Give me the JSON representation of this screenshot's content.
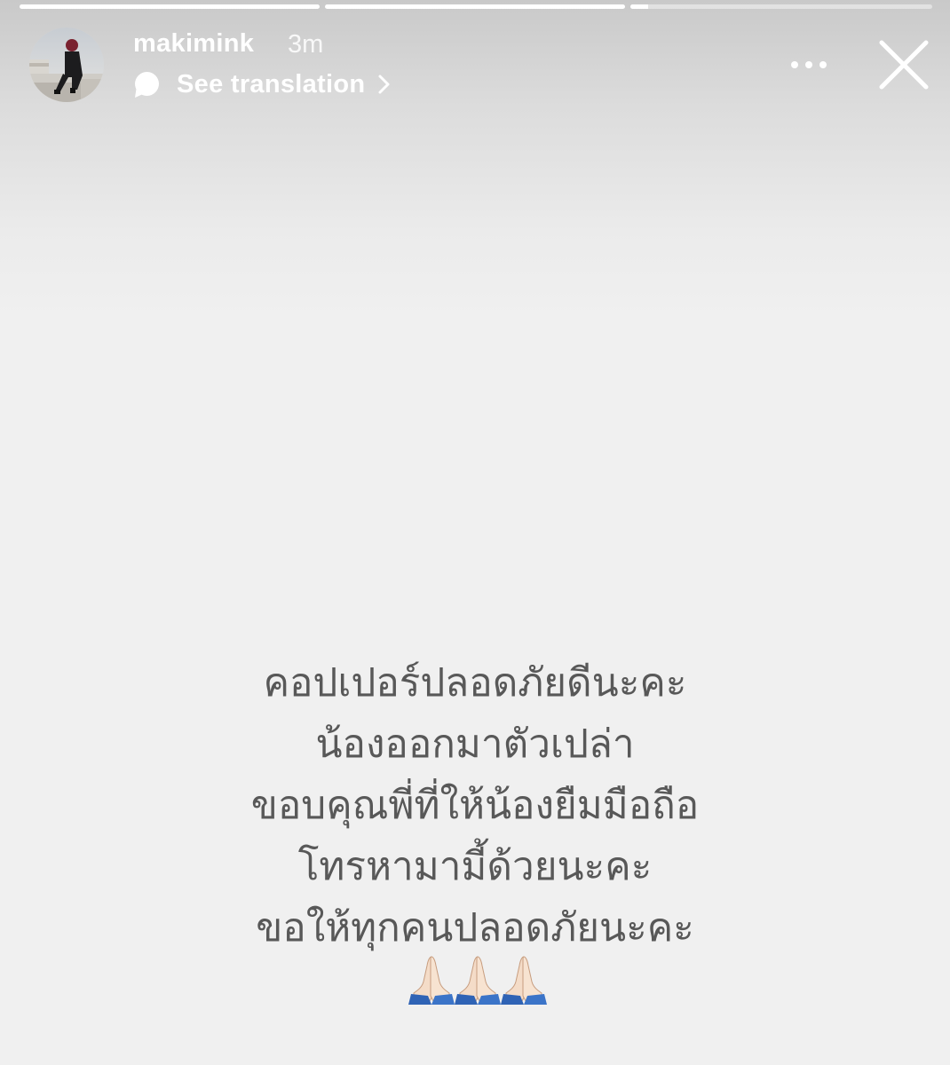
{
  "story": {
    "progress": [
      1.0,
      1.0,
      0.06
    ],
    "user": {
      "username": "makimink",
      "timestamp": "3m",
      "avatar_alt": "profile photo"
    },
    "translation": {
      "label": "See translation",
      "icon": "speech-bubble-icon",
      "chevron": "chevron-right-icon"
    },
    "actions": {
      "more_icon": "more-horizontal-icon",
      "close_icon": "close-icon"
    },
    "text_lines": [
      "คอปเปอร์ปลอดภัยดีนะคะ",
      "น้องออกมาตัวเปล่า",
      "ขอบคุณพี่ที่ให้น้องยืมมือถือ",
      "โทรหามามี้ด้วยนะคะ",
      "ขอให้ทุกคนปลอดภัยนะคะ"
    ],
    "emoji": "🙏🏻🙏🏻🙏🏻",
    "colors": {
      "text": "#585858",
      "background": "#f0f0f0",
      "overlay_text": "#ffffff"
    }
  }
}
